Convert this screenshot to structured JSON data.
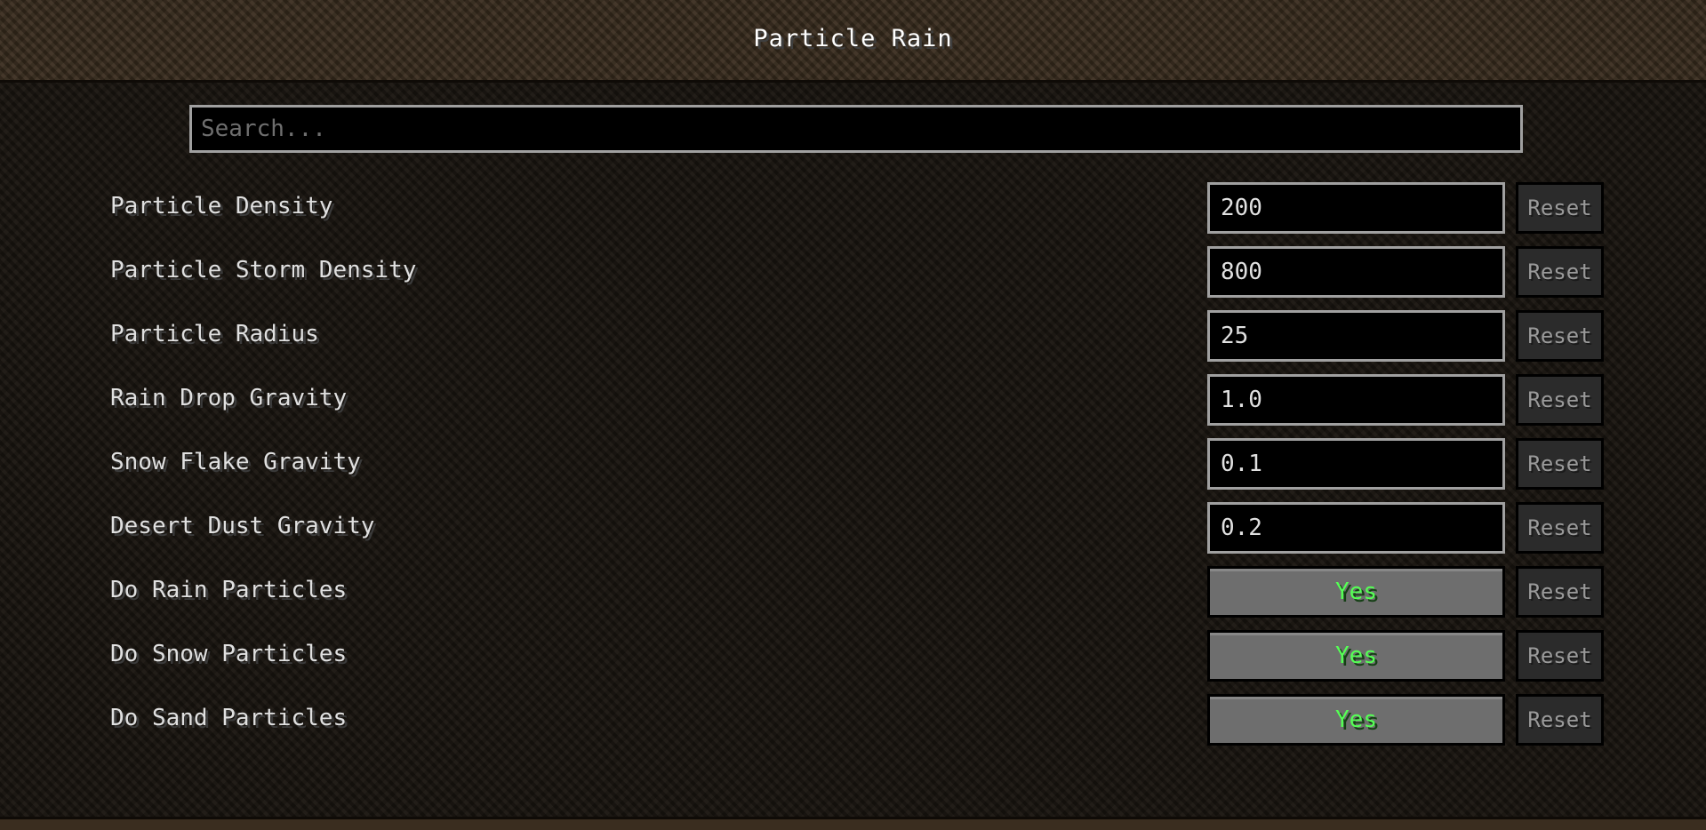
{
  "window": {
    "title": "Particle Rain"
  },
  "search": {
    "placeholder": "Search...",
    "value": ""
  },
  "reset_label": "Reset",
  "settings": [
    {
      "label": "Particle Density",
      "type": "number",
      "value": "200"
    },
    {
      "label": "Particle Storm Density",
      "type": "number",
      "value": "800"
    },
    {
      "label": "Particle Radius",
      "type": "number",
      "value": "25"
    },
    {
      "label": "Rain Drop Gravity",
      "type": "number",
      "value": "1.0"
    },
    {
      "label": "Snow Flake Gravity",
      "type": "number",
      "value": "0.1"
    },
    {
      "label": "Desert Dust Gravity",
      "type": "number",
      "value": "0.2"
    },
    {
      "label": "Do Rain Particles",
      "type": "toggle",
      "value": "Yes"
    },
    {
      "label": "Do Snow Particles",
      "type": "toggle",
      "value": "Yes"
    },
    {
      "label": "Do Sand Particles",
      "type": "toggle",
      "value": "Yes"
    }
  ],
  "colors": {
    "toggle_on_text": "#55ff55",
    "label_text": "#e0e0e0",
    "reset_text": "#9a9a9a"
  }
}
